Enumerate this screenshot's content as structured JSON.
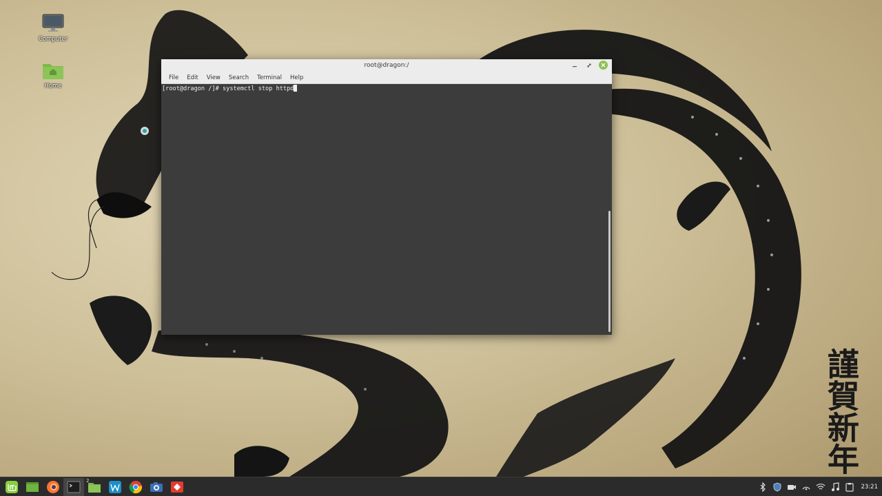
{
  "desktop": {
    "icons": [
      {
        "label": "Computer",
        "icon": "monitor-icon"
      },
      {
        "label": "Home",
        "icon": "folder-home-icon"
      }
    ],
    "kanji": "謹賀新年"
  },
  "terminal": {
    "title": "root@dragon:/",
    "menu": [
      "File",
      "Edit",
      "View",
      "Search",
      "Terminal",
      "Help"
    ],
    "prompt": "[root@dragon /]# ",
    "command": "systemctl stop httpd",
    "colors": {
      "background": "#3c3c3c",
      "text": "#f0f0f0",
      "close_button": "#8cc152"
    }
  },
  "taskbar": {
    "launchers": [
      {
        "name": "mint-menu-icon"
      },
      {
        "name": "show-desktop-icon"
      },
      {
        "name": "firefox-icon"
      },
      {
        "name": "terminal-icon",
        "active": true
      },
      {
        "name": "files-icon",
        "badge": "2"
      },
      {
        "name": "wps-icon"
      },
      {
        "name": "chrome-icon"
      },
      {
        "name": "screenshot-icon"
      },
      {
        "name": "anydesk-icon"
      }
    ],
    "tray": [
      "bluetooth-icon",
      "shield-icon",
      "camera-icon",
      "network-icon",
      "wifi-icon",
      "music-icon",
      "clipboard-icon"
    ],
    "clock": "23:21"
  }
}
